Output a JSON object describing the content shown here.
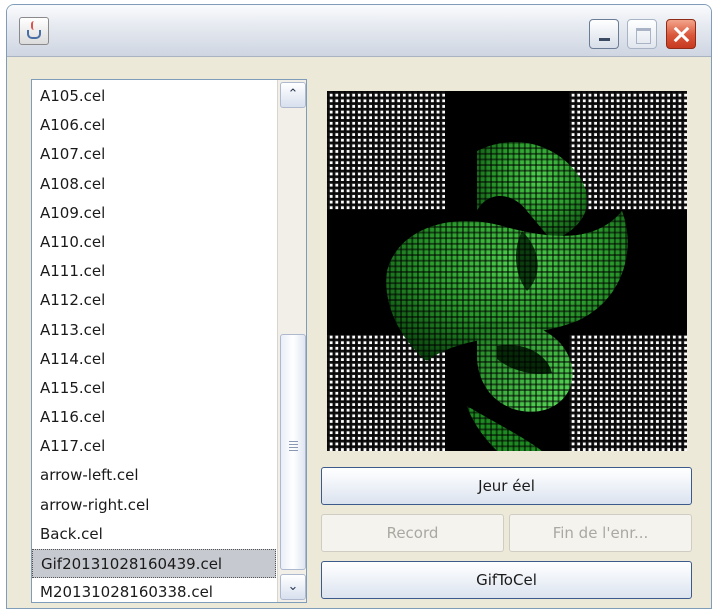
{
  "window": {
    "title": "",
    "icons": {
      "app": "java-cup-icon",
      "minimize": "minimize-icon",
      "maximize": "maximize-icon",
      "close": "close-icon"
    }
  },
  "file_list": {
    "items": [
      "A105.cel",
      "A106.cel",
      "A107.cel",
      "A108.cel",
      "A109.cel",
      "A110.cel",
      "A111.cel",
      "A112.cel",
      "A113.cel",
      "A114.cel",
      "A115.cel",
      "A116.cel",
      "A117.cel",
      "arrow-left.cel",
      "arrow-right.cel",
      "Back.cel",
      "Gif20131028160439.cel",
      "M20131028160338.cel"
    ],
    "selected": "Gif20131028160439.cel",
    "scroll_up_glyph": "⌃",
    "scroll_down_glyph": "⌄"
  },
  "led_display": {
    "colors": {
      "background": "#ffffff",
      "grid": "#1b1b1b",
      "cross": "#000000",
      "led_bright": "#3cc83c",
      "led_dark": "#0e5a12"
    }
  },
  "buttons": {
    "play": "Jeur éel",
    "record": "Record",
    "stop": "Fin de l'enr...",
    "gif_to_cel": "GifToCel"
  }
}
